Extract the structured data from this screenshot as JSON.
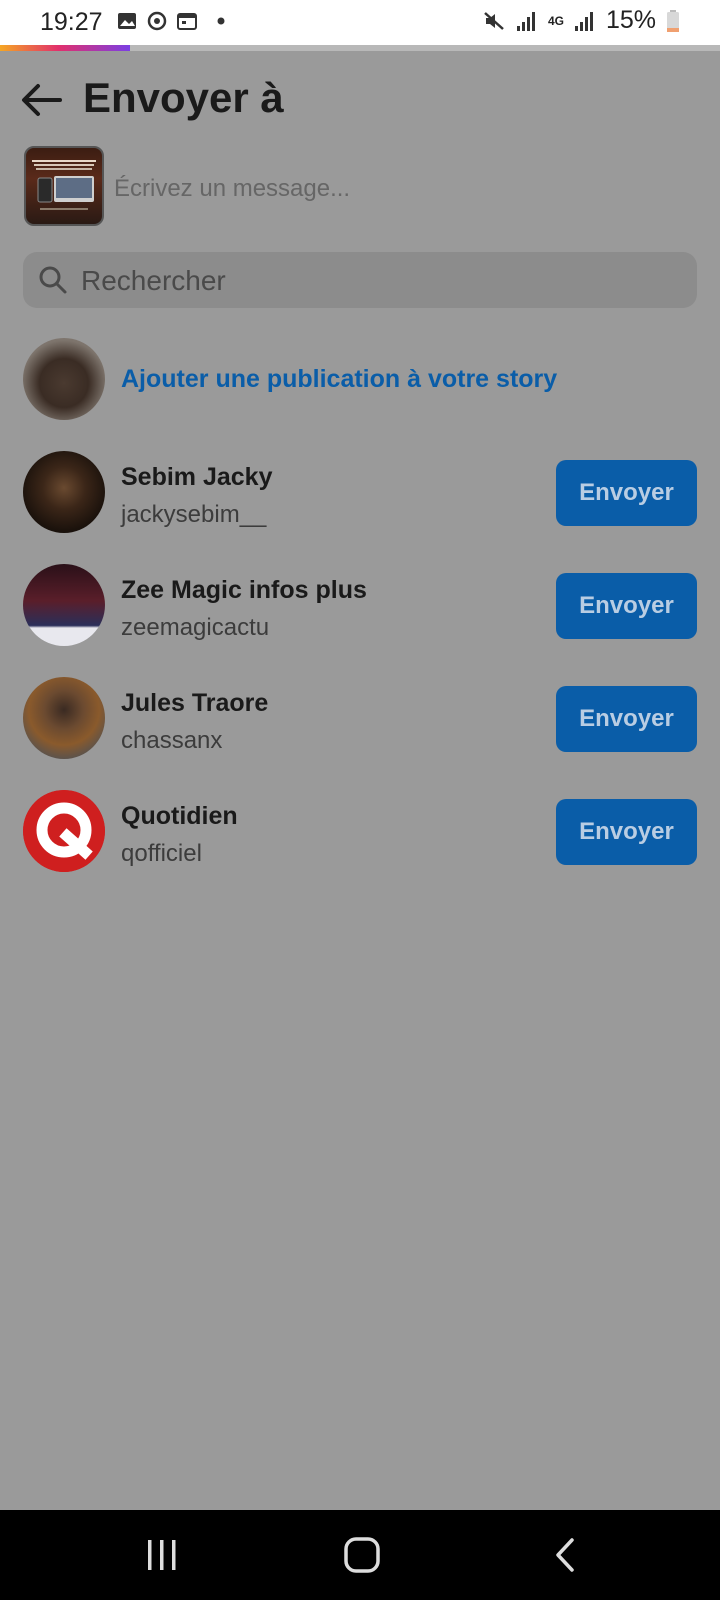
{
  "status_bar": {
    "time": "19:27",
    "battery": "15%",
    "network": "4G",
    "icons": [
      "image-icon",
      "sync-icon",
      "calendar-icon",
      "dot-icon",
      "mute-icon",
      "signal-icon",
      "signal-icon",
      "battery-icon"
    ]
  },
  "header": {
    "title": "Envoyer à"
  },
  "message": {
    "placeholder": "Écrivez un message..."
  },
  "search": {
    "placeholder": "Rechercher"
  },
  "story": {
    "label": "Ajouter une publication à votre story"
  },
  "contacts": [
    {
      "name": "Sebim Jacky",
      "handle": "jackysebim__",
      "button": "Envoyer"
    },
    {
      "name": "Zee Magic infos plus",
      "handle": "zeemagicactu",
      "button": "Envoyer"
    },
    {
      "name": "Jules Traore",
      "handle": "chassanx",
      "button": "Envoyer"
    },
    {
      "name": "Quotidien",
      "handle": "qofficiel",
      "button": "Envoyer"
    }
  ],
  "colors": {
    "accent": "#0a5da8",
    "overlay_background": "#9a9a9a",
    "nav_background": "#000000"
  },
  "nav": {
    "icons": [
      "recent-apps-icon",
      "home-icon",
      "back-icon"
    ]
  }
}
